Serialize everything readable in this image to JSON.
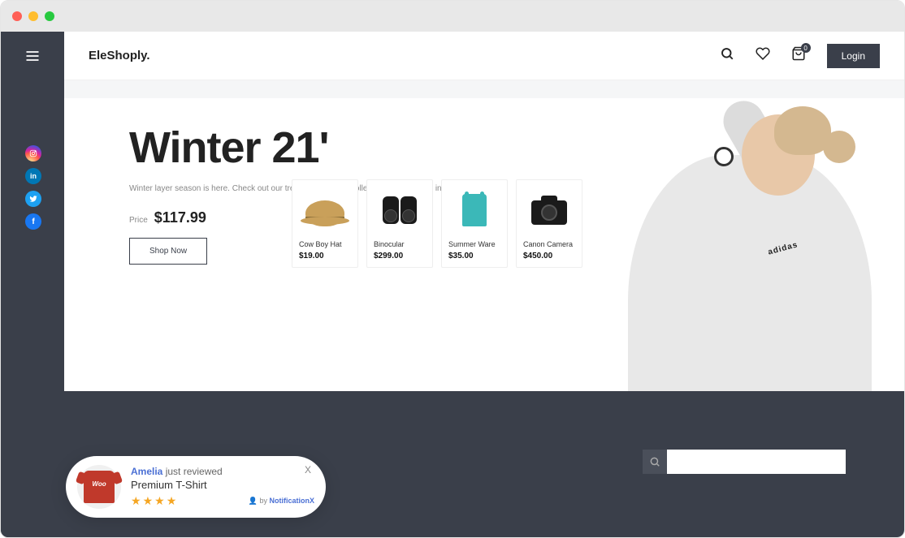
{
  "brand": "EleShoply.",
  "header": {
    "login_label": "Login",
    "cart_count": "0"
  },
  "hero": {
    "title": "Winter 21'",
    "subtitle": "Winter layer season is here. Check out our trendy new winter collection to stay warm in style.",
    "price_label": "Price",
    "price_value": "$117.99",
    "cta_label": "Shop Now",
    "model_brand": "adidas"
  },
  "products": [
    {
      "name": "Cow Boy Hat",
      "price": "$19.00"
    },
    {
      "name": "Binocular",
      "price": "$299.00"
    },
    {
      "name": "Summer Ware",
      "price": "$35.00"
    },
    {
      "name": "Canon Camera",
      "price": "$450.00"
    }
  ],
  "notification": {
    "reviewer": "Amelia",
    "action": "just reviewed",
    "product": "Premium T-Shirt",
    "shirt_text": "Woo",
    "rating": 4,
    "by_prefix": "by",
    "by_brand": "NotificationX",
    "close": "X"
  },
  "footer_search": {
    "placeholder": ""
  }
}
